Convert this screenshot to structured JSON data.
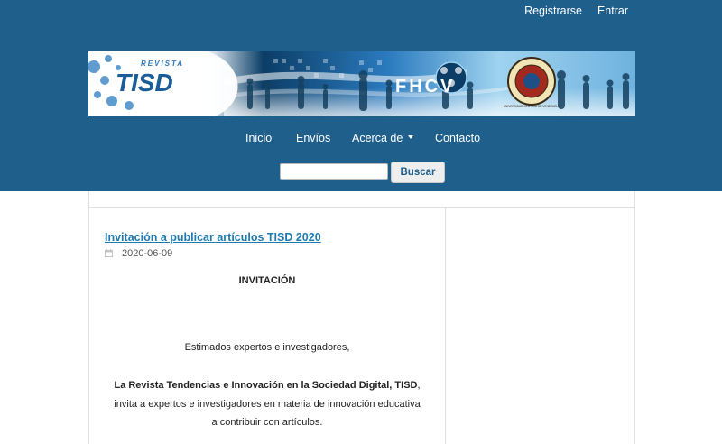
{
  "user_nav": {
    "register": "Registrarse",
    "login": "Entrar"
  },
  "banner": {
    "revista": "REVISTA",
    "tisd": "TISD",
    "logo_text": "FHCV",
    "seal_text": "UNIVERSIDAD CENTRAL DE VENEZUELA",
    "colors": {
      "dark": "#0b3d66",
      "mid": "#2b7bbf",
      "light": "#9fd3ef"
    }
  },
  "main_nav": {
    "home": "Inicio",
    "submissions": "Envíos",
    "about": "Acerca de",
    "contact": "Contacto"
  },
  "search": {
    "value": "",
    "button": "Buscar"
  },
  "article": {
    "title": "Invitación a publicar artículos TISD 2020",
    "date": "2020-06-09",
    "heading": "INVITACIÓN",
    "greeting": "Estimados expertos e investigadores,",
    "journal_name": "La Revista Tendencias e Innovación en la Sociedad Digital, TISD",
    "journal_suffix": ",",
    "body_line1": "invita a expertos e investigadores en materia de innovación educativa",
    "body_line2": "a contribuir con artículos."
  },
  "colors": {
    "header": "#1e5f8c",
    "link": "#1e7ab0",
    "border": "#e1e1e1"
  }
}
